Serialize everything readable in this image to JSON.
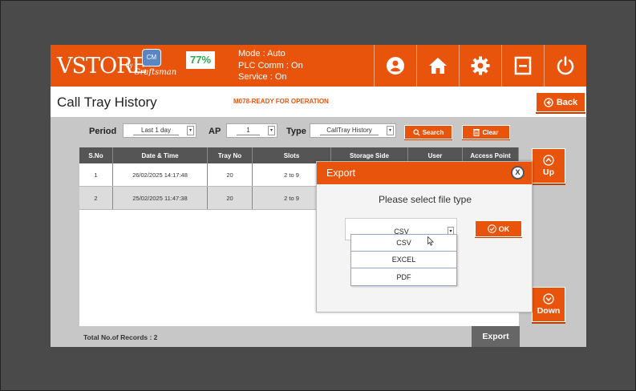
{
  "header": {
    "logo_text": "VSTORE",
    "logo_by": "by",
    "logo_badge": "CM",
    "logo_brand": "Craftsman",
    "percent": "77%",
    "mode": "Mode : Auto",
    "plc_comm": "PLC Comm : On",
    "service": "Service : On",
    "icons": [
      "user-icon",
      "home-icon",
      "gear-icon",
      "minimize-icon",
      "power-icon"
    ],
    "accent_color": "#e8540c"
  },
  "page": {
    "title": "Call Tray History",
    "status_message": "M078-READY FOR OPERATION",
    "back_label": "Back"
  },
  "filters": {
    "period_label": "Period",
    "period_value": "Last 1 day",
    "ap_label": "AP",
    "ap_value": "1",
    "type_label": "Type",
    "type_value": "CallTray History",
    "search_label": "Search",
    "clear_label": "Clear"
  },
  "table": {
    "columns": [
      "S.No",
      "Date & Time",
      "Tray No",
      "Slots",
      "Storage Side",
      "User",
      "Access Point"
    ],
    "rows": [
      [
        "1",
        "26/02/2025 14:17:48",
        "20",
        "2 to 9",
        "",
        "",
        ""
      ],
      [
        "2",
        "25/02/2025 11:47:38",
        "20",
        "2 to 9",
        "",
        "",
        ""
      ]
    ]
  },
  "footer": {
    "total_records": "Total No.of Records : 2",
    "export_label": "Export"
  },
  "side_nav": {
    "up_label": "Up",
    "down_label": "Down"
  },
  "dialog": {
    "title": "Export",
    "close_label": "X",
    "message": "Please select file type",
    "selected": "CSV",
    "ok_label": "OK",
    "options": [
      "CSV",
      "EXCEL",
      "PDF"
    ]
  }
}
